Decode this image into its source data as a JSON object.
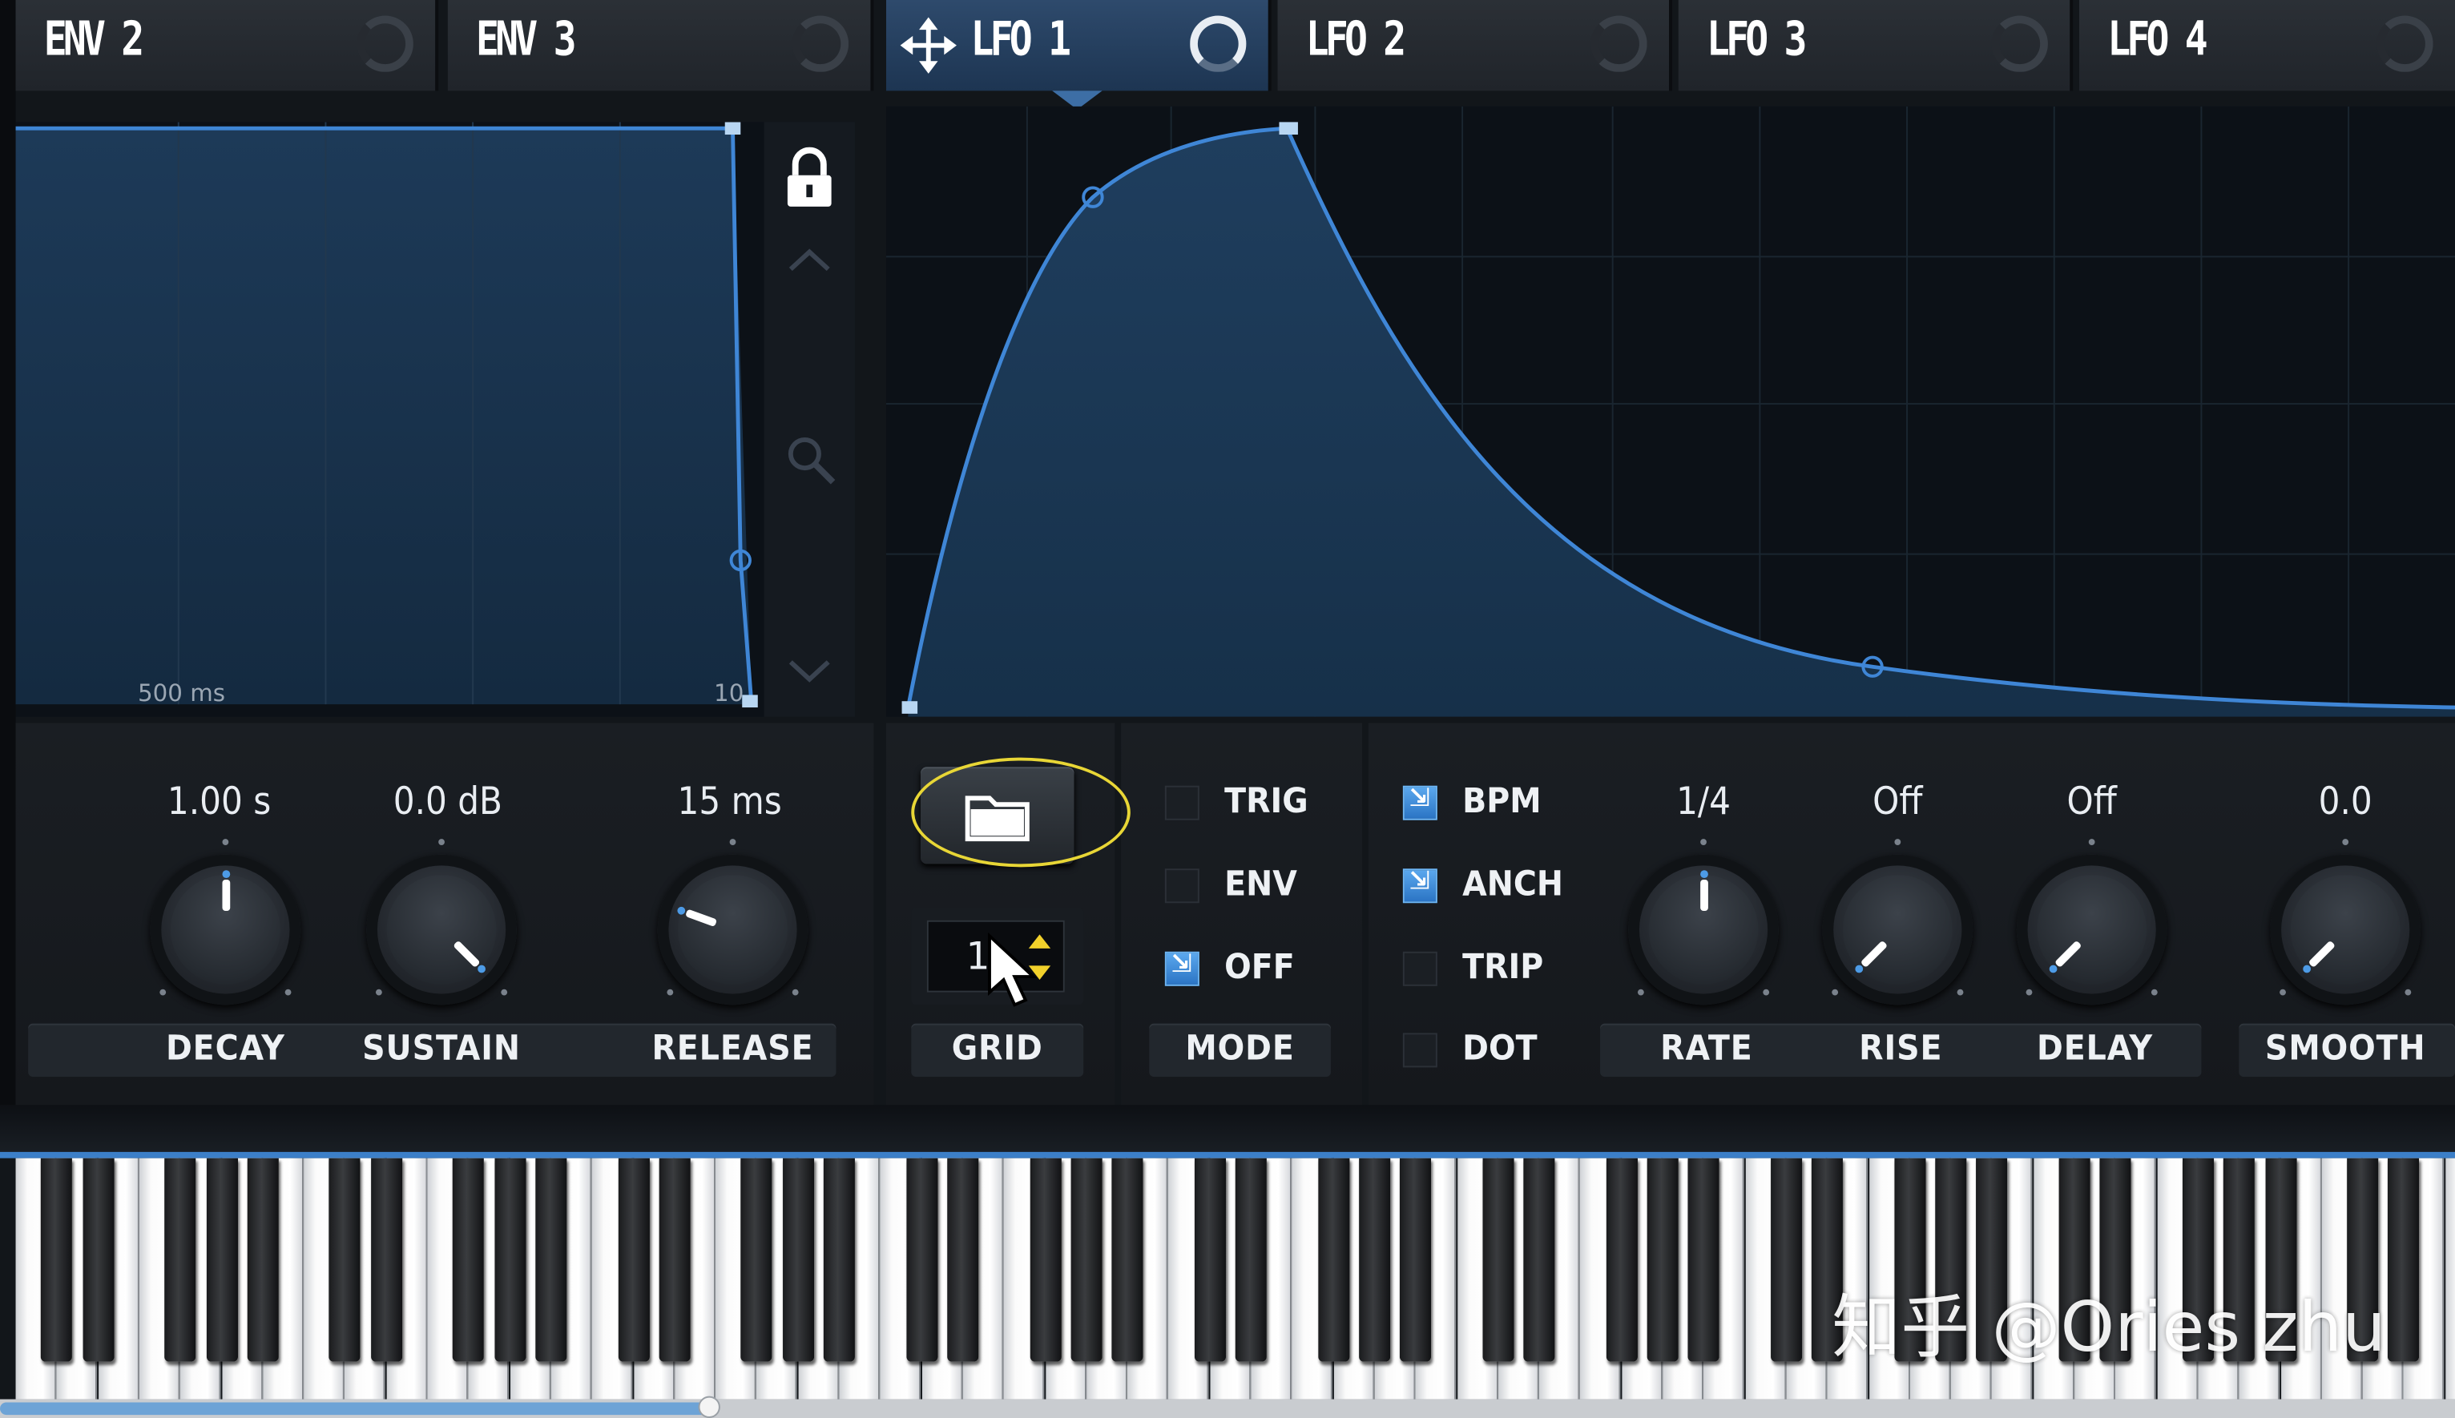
{
  "tabs": [
    {
      "label": "ENV 2",
      "active": false
    },
    {
      "label": "ENV 3",
      "active": false
    },
    {
      "label": "LFO 1",
      "active": true
    },
    {
      "label": "LFO 2",
      "active": false
    },
    {
      "label": "LFO 3",
      "active": false
    },
    {
      "label": "LFO 4",
      "active": false
    }
  ],
  "env_graph": {
    "time_label_1": "500 ms",
    "time_label_2": "10"
  },
  "env_knobs": [
    {
      "value": "1.00 s",
      "label": "DECAY"
    },
    {
      "value": "0.0 dB",
      "label": "SUSTAIN"
    },
    {
      "value": "15 ms",
      "label": "RELEASE"
    }
  ],
  "lfo": {
    "grid": {
      "value": "1",
      "label": "GRID"
    },
    "mode": {
      "label": "MODE",
      "options": [
        {
          "label": "TRIG",
          "checked": false
        },
        {
          "label": "ENV",
          "checked": false
        },
        {
          "label": "OFF",
          "checked": true
        }
      ]
    },
    "timing": [
      {
        "label": "BPM",
        "checked": true
      },
      {
        "label": "ANCH",
        "checked": true
      },
      {
        "label": "TRIP",
        "checked": false
      },
      {
        "label": "DOT",
        "checked": false
      }
    ],
    "knobs": [
      {
        "value": "1/4",
        "label": "RATE"
      },
      {
        "value": "Off",
        "label": "RISE"
      },
      {
        "value": "Off",
        "label": "DELAY"
      },
      {
        "value": "0.0",
        "label": "SMOOTH"
      }
    ]
  },
  "watermark": "知乎 @Ories zhu",
  "colors": {
    "accent": "#3f86d6",
    "highlight_ring": "#e8d636",
    "spinner": "#f2d12b"
  }
}
